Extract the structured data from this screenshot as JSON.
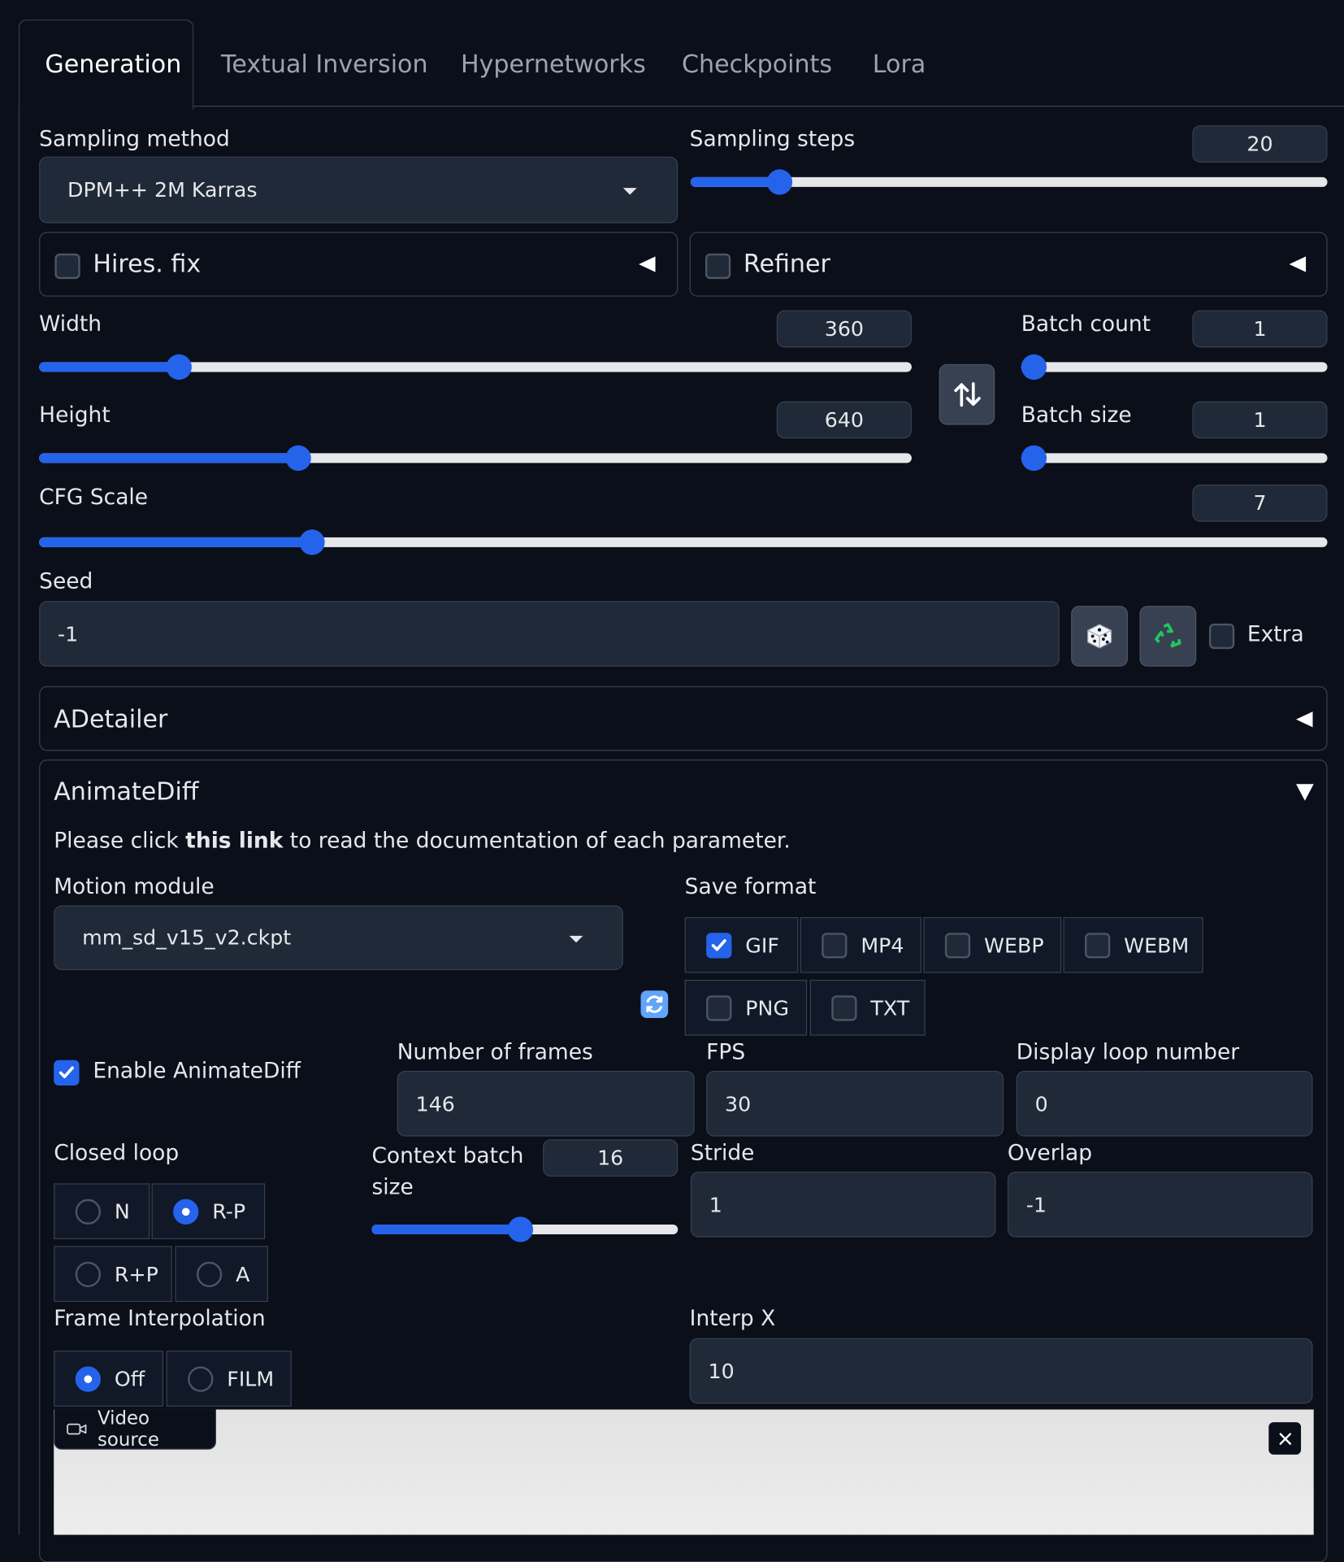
{
  "tabs": {
    "generation": "Generation",
    "textual_inversion": "Textual Inversion",
    "hypernetworks": "Hypernetworks",
    "checkpoints": "Checkpoints",
    "lora": "Lora"
  },
  "sampling": {
    "method_label": "Sampling method",
    "method_value": "DPM++ 2M Karras",
    "steps_label": "Sampling steps",
    "steps_value": "20",
    "steps_fraction": 0.14
  },
  "hires": {
    "label": "Hires. fix"
  },
  "refiner": {
    "label": "Refiner"
  },
  "width": {
    "label": "Width",
    "value": "360",
    "fraction": 0.16
  },
  "height": {
    "label": "Height",
    "value": "640",
    "fraction": 0.297
  },
  "batch_count": {
    "label": "Batch count",
    "value": "1",
    "fraction": 0.0
  },
  "batch_size": {
    "label": "Batch size",
    "value": "1",
    "fraction": 0.0
  },
  "cfg": {
    "label": "CFG Scale",
    "value": "7",
    "fraction": 0.212
  },
  "seed": {
    "label": "Seed",
    "value": "-1",
    "extra_label": "Extra"
  },
  "adetailer": {
    "title": "ADetailer"
  },
  "animatediff": {
    "title": "AnimateDiff",
    "doc_prefix": "Please click ",
    "doc_link": "this link",
    "doc_suffix": " to read the documentation of each parameter.",
    "motion_label": "Motion module",
    "motion_value": "mm_sd_v15_v2.ckpt",
    "save_format_label": "Save format",
    "formats": {
      "gif": "GIF",
      "mp4": "MP4",
      "webp": "WEBP",
      "webm": "WEBM",
      "png": "PNG",
      "txt": "TXT"
    },
    "enable_label": "Enable AnimateDiff",
    "frames_label": "Number of frames",
    "frames_value": "146",
    "fps_label": "FPS",
    "fps_value": "30",
    "loop_label": "Display loop number",
    "loop_value": "0",
    "closed_loop_label": "Closed loop",
    "closed_loop": {
      "n": "N",
      "rp": "R-P",
      "rplusp": "R+P",
      "a": "A"
    },
    "context_label_1": "Context batch",
    "context_label_2": "size",
    "context_value": "16",
    "context_fraction": 0.485,
    "stride_label": "Stride",
    "stride_value": "1",
    "overlap_label": "Overlap",
    "overlap_value": "-1",
    "interp_label": "Frame Interpolation",
    "interp": {
      "off": "Off",
      "film": "FILM"
    },
    "interp_x_label": "Interp X",
    "interp_x_value": "10",
    "video_source_label": "Video source"
  },
  "icons": {
    "swap": "swap-arrows-icon",
    "dice": "dice-icon",
    "recycle": "recycle-icon",
    "refresh": "refresh-icon",
    "video": "video-camera-icon",
    "close": "close-icon"
  },
  "colors": {
    "accent": "#2563eb",
    "background": "#0b0f19",
    "surface": "#1f2937",
    "border": "#374151"
  }
}
